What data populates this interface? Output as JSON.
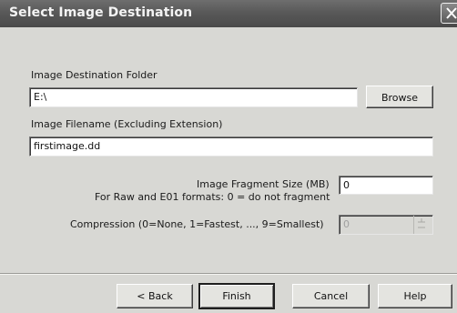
{
  "window": {
    "title": "Select Image Destination"
  },
  "destination_folder": {
    "label": "Image Destination Folder",
    "value": "E:\\",
    "browse_label": "Browse"
  },
  "filename": {
    "label": "Image Filename (Excluding Extension)",
    "value": "firstimage.dd"
  },
  "fragment": {
    "label": "Image Fragment Size (MB)",
    "hint": "For Raw and E01 formats: 0 = do not fragment",
    "value": "0"
  },
  "compression": {
    "label": "Compression (0=None, 1=Fastest, ..., 9=Smallest)",
    "value": "0"
  },
  "buttons": {
    "back_label": "< Back",
    "finish_label": "Finish",
    "cancel_label": "Cancel",
    "help_label": "Help"
  },
  "icons": {
    "close": "close-icon",
    "spin_up": "spin-up-icon",
    "spin_down": "spin-down-icon"
  }
}
